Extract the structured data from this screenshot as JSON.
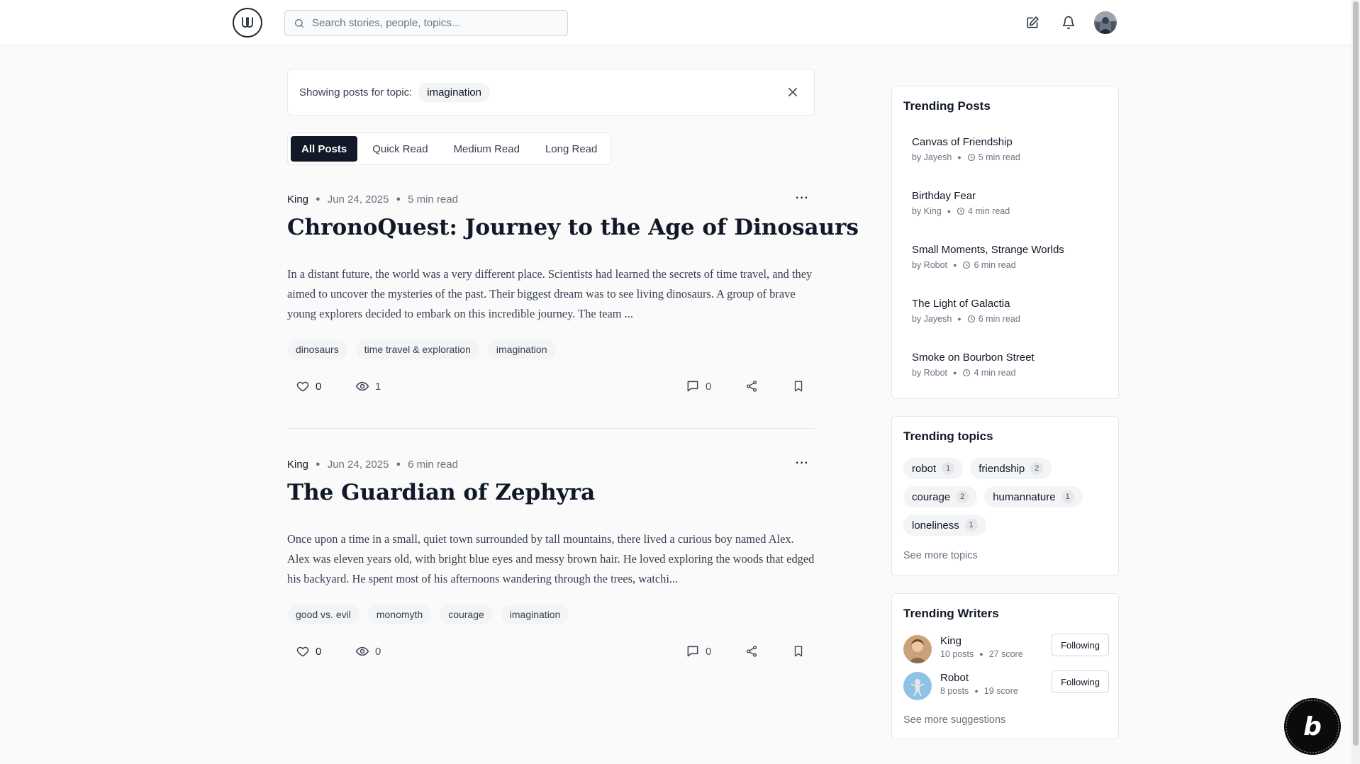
{
  "header": {
    "search_placeholder": "Search stories, people, topics..."
  },
  "topic_filter": {
    "label": "Showing posts for topic:",
    "topic": "imagination"
  },
  "tabs": [
    {
      "label": "All Posts",
      "active": true
    },
    {
      "label": "Quick Read",
      "active": false
    },
    {
      "label": "Medium Read",
      "active": false
    },
    {
      "label": "Long Read",
      "active": false
    }
  ],
  "posts": [
    {
      "author": "King",
      "date": "Jun 24, 2025",
      "read_time": "5 min read",
      "title": "ChronoQuest: Journey to the Age of Dinosaurs",
      "excerpt": "In a distant future, the world was a very different place. Scientists had learned the secrets of time travel, and they aimed to uncover the mysteries of the past. Their biggest dream was to see living dinosaurs. A group of brave young explorers decided to embark on this incredible journey. The team ...",
      "tags": [
        "dinosaurs",
        "time travel & exploration",
        "imagination"
      ],
      "likes": "0",
      "views": "1",
      "comments": "0"
    },
    {
      "author": "King",
      "date": "Jun 24, 2025",
      "read_time": "6 min read",
      "title": "The Guardian of Zephyra",
      "excerpt": "Once upon a time in a small, quiet town surrounded by tall mountains, there lived a curious boy named Alex. Alex was eleven years old, with bright blue eyes and messy brown hair. He loved exploring the woods that edged his backyard. He spent most of his afternoons wandering through the trees, watchi...",
      "tags": [
        "good vs. evil",
        "monomyth",
        "courage",
        "imagination"
      ],
      "likes": "0",
      "views": "0",
      "comments": "0"
    }
  ],
  "trending_posts": {
    "title": "Trending Posts",
    "items": [
      {
        "title": "Canvas of Friendship",
        "by": "by Jayesh",
        "read": "5 min read"
      },
      {
        "title": "Birthday Fear",
        "by": "by King",
        "read": "4 min read"
      },
      {
        "title": "Small Moments, Strange Worlds",
        "by": "by Robot",
        "read": "6 min read"
      },
      {
        "title": "The Light of Galactia",
        "by": "by Jayesh",
        "read": "6 min read"
      },
      {
        "title": "Smoke on Bourbon Street",
        "by": "by Robot",
        "read": "4 min read"
      }
    ]
  },
  "trending_topics": {
    "title": "Trending topics",
    "items": [
      {
        "name": "robot",
        "count": "1"
      },
      {
        "name": "friendship",
        "count": "2"
      },
      {
        "name": "courage",
        "count": "2"
      },
      {
        "name": "humannature",
        "count": "1"
      },
      {
        "name": "loneliness",
        "count": "1"
      }
    ],
    "see_more": "See more topics"
  },
  "trending_writers": {
    "title": "Trending Writers",
    "items": [
      {
        "name": "King",
        "posts": "10 posts",
        "score": "27 score",
        "button": "Following"
      },
      {
        "name": "Robot",
        "posts": "8 posts",
        "score": "19 score",
        "button": "Following"
      }
    ],
    "see_more": "See more suggestions"
  },
  "colors": {
    "accent": "#111827",
    "muted": "#6b7280",
    "chip_bg": "#f3f4f6",
    "border": "#e5e7eb"
  }
}
